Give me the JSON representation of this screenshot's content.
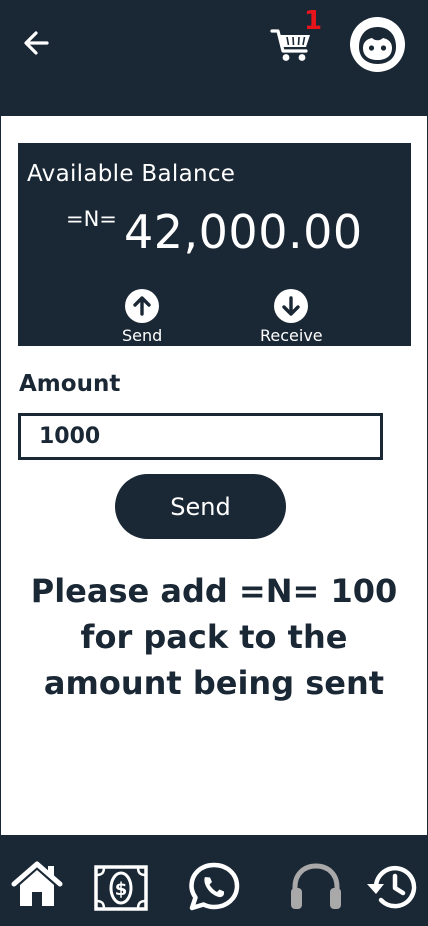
{
  "header": {
    "cart_count": "1"
  },
  "balance_card": {
    "title": "Available Balance",
    "currency_symbol": "=N=",
    "amount": "42,000.00",
    "send_label": "Send",
    "receive_label": "Receive"
  },
  "form": {
    "amount_label": "Amount",
    "amount_value": "1000",
    "send_button_label": "Send"
  },
  "notice": {
    "line1": "Please add =N= 100",
    "line2": "for pack to the",
    "line3": "amount being sent"
  },
  "icons": {
    "back": "arrow-left-icon",
    "cart": "cart-icon",
    "avatar": "face-icon",
    "home": "home-icon",
    "money": "money-icon",
    "whatsapp": "whatsapp-icon",
    "support": "headphones-icon",
    "history": "history-icon"
  },
  "colors": {
    "primary": "#1a2734",
    "badge": "#e8141c",
    "surface": "#ffffff",
    "muted_icon": "#a9a9a9"
  }
}
